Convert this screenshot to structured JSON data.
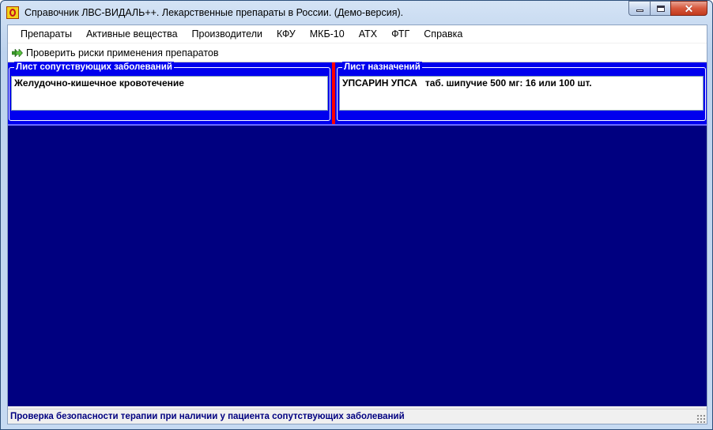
{
  "window": {
    "title": "Справочник ЛВС-ВИДАЛЬ++. Лекарственные препараты в России. (Демо-версия).",
    "close_symbol": "✕"
  },
  "menu": {
    "items": [
      "Препараты",
      "Активные вещества",
      "Производители",
      "КФУ",
      "МКБ-10",
      "АТХ",
      "ФТГ",
      "Справка"
    ]
  },
  "toolbar": {
    "check_risks_label": "Проверить риски применения препаратов",
    "check_risks_icon": "double-arrow-right-icon"
  },
  "panels": {
    "comorbidities": {
      "title": "Лист сопутствующих заболеваний",
      "items": [
        "Желудочно-кишечное кровотечение"
      ]
    },
    "prescriptions": {
      "title": "Лист назначений",
      "items": [
        "УПСАРИН УПСА   таб. шипучие 500 мг: 16 или 100 шт."
      ]
    }
  },
  "status": {
    "text": "Проверка безопасности терапии при наличии у пациента сопутствующих заболеваний"
  },
  "colors": {
    "main_background": "#000080",
    "panel_strip": "#0000ee",
    "splitter": "#ff0000",
    "status_text": "#000080"
  }
}
